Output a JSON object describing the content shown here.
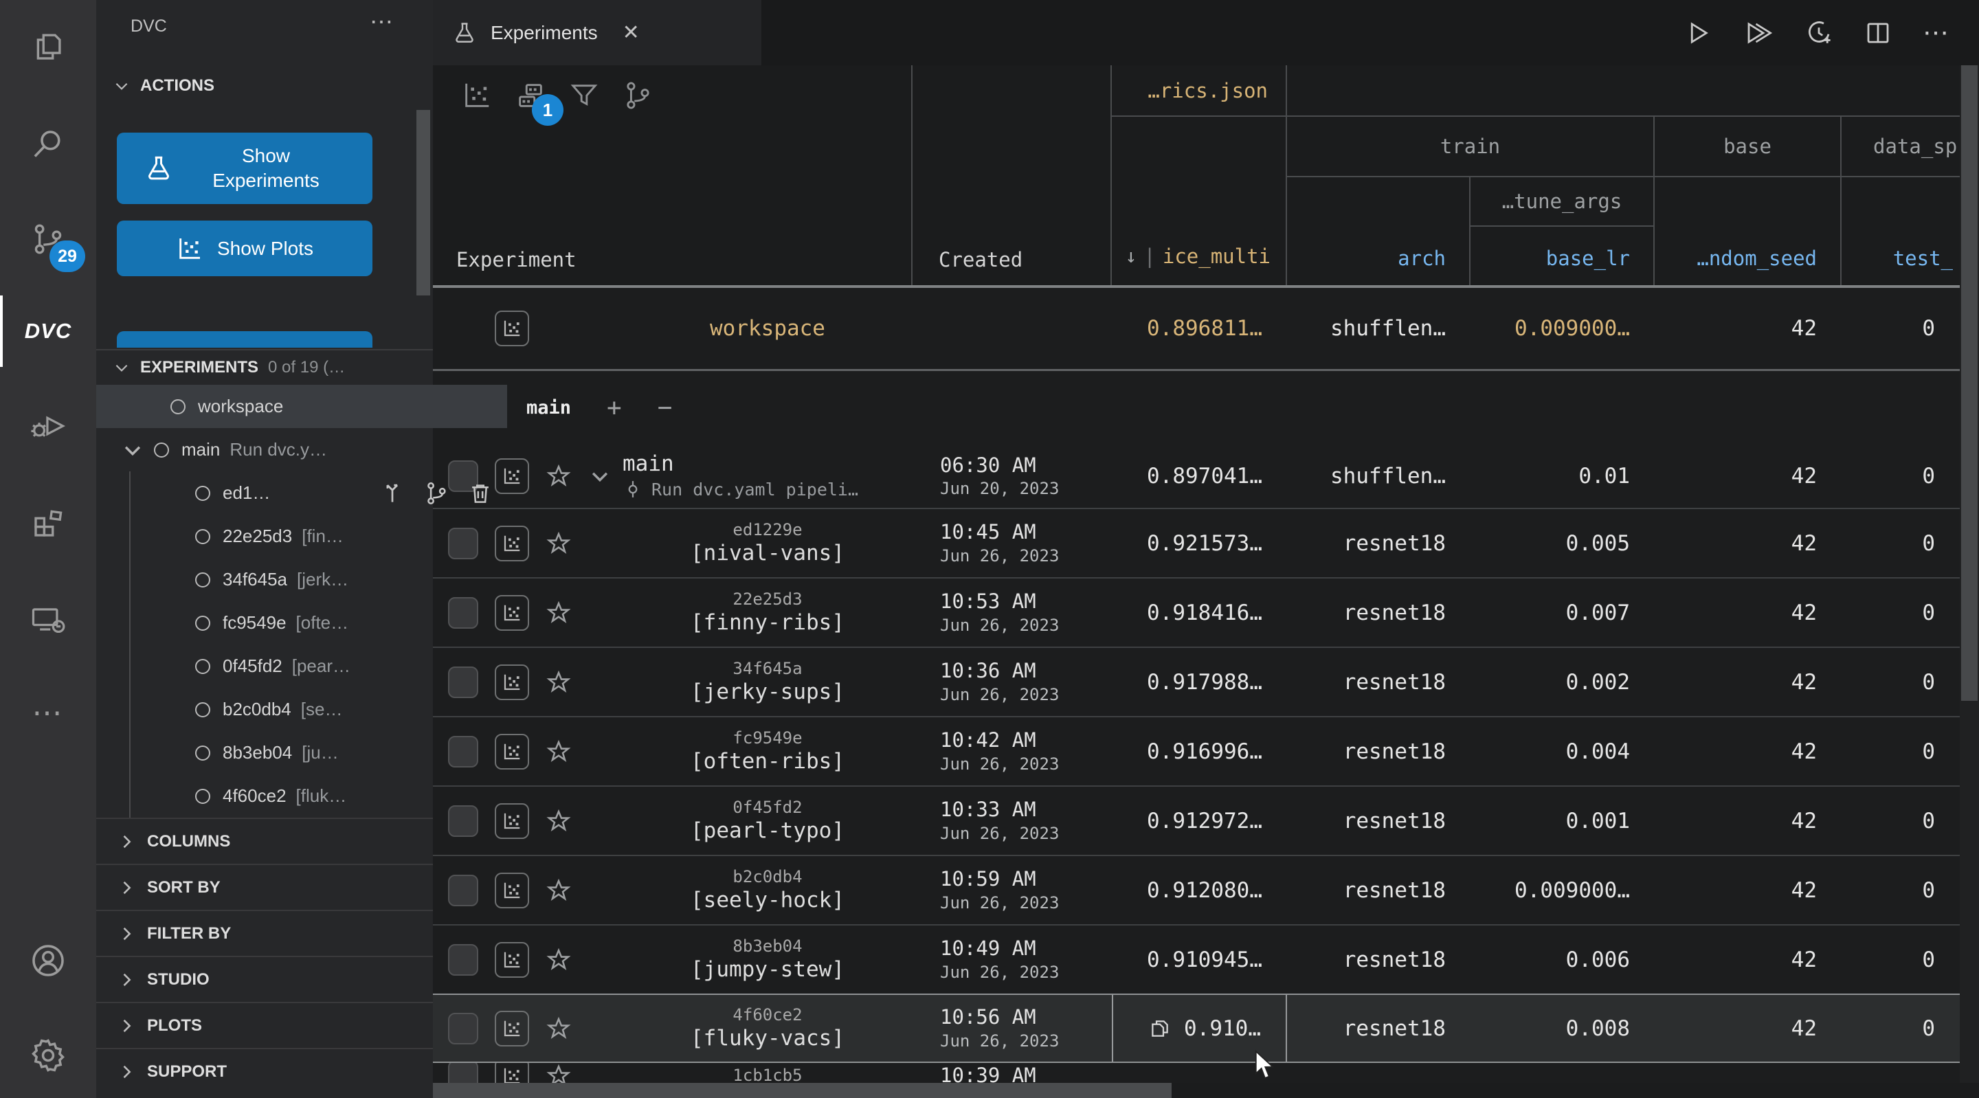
{
  "colors": {
    "accent_blue": "#1573b2",
    "badge_blue": "#1b86d3",
    "metric_tan": "#d9b679",
    "param_blue": "#77b7f0",
    "branch_blue": "#3f94e0"
  },
  "activity_bar": {
    "items": [
      {
        "icon": "files-icon"
      },
      {
        "icon": "search-icon"
      },
      {
        "icon": "source-control-icon",
        "badge": "29"
      },
      {
        "icon": "dvc-icon",
        "label": "DVC",
        "active": true
      },
      {
        "icon": "debug-icon"
      },
      {
        "icon": "extensions-icon"
      },
      {
        "icon": "remote-icon"
      },
      {
        "icon": "more-icon"
      }
    ],
    "bottom_items": [
      {
        "icon": "account-icon"
      },
      {
        "icon": "settings-icon"
      }
    ]
  },
  "sidebar": {
    "title": "DVC",
    "menu": "⋯",
    "actions": {
      "label": "ACTIONS",
      "buttons": [
        {
          "label": "Show Experiments",
          "icon": "flask-icon"
        },
        {
          "label": "Show Plots",
          "icon": "scatter-icon"
        },
        {
          "label": "",
          "icon": ""
        }
      ]
    },
    "experiments_header": {
      "label": "EXPERIMENTS",
      "count": "0 of 19 (…"
    },
    "tree": [
      {
        "label": "workspace",
        "selected": true,
        "indent": 0
      },
      {
        "label": "main",
        "desc": "Run dvc.y…",
        "chevron": true,
        "indent": 0
      },
      {
        "label": "ed1…",
        "indent": 1,
        "actions": [
          "apply-icon",
          "branch-icon",
          "trash-icon"
        ]
      },
      {
        "label": "22e25d3",
        "desc": "[fin…",
        "indent": 1
      },
      {
        "label": "34f645a",
        "desc": "[jerk…",
        "indent": 1
      },
      {
        "label": "fc9549e",
        "desc": "[ofte…",
        "indent": 1
      },
      {
        "label": "0f45fd2",
        "desc": "[pear…",
        "indent": 1
      },
      {
        "label": "b2c0db4",
        "desc": "[se…",
        "indent": 1
      },
      {
        "label": "8b3eb04",
        "desc": "[ju…",
        "indent": 1
      },
      {
        "label": "4f60ce2",
        "desc": "[fluk…",
        "indent": 1
      }
    ],
    "sections": [
      "COLUMNS",
      "SORT BY",
      "FILTER BY",
      "STUDIO",
      "PLOTS",
      "SUPPORT"
    ]
  },
  "editor": {
    "tab": {
      "label": "Experiments",
      "icon": "flask-icon",
      "close": "✕"
    },
    "actions": [
      "run-icon",
      "run-all-icon",
      "clock-add-icon",
      "split-editor-icon",
      "ellipsis-icon"
    ]
  },
  "table": {
    "toolbar": {
      "icons": [
        "scatter-icon",
        "columns-icon",
        "filter-icon",
        "branch-icon"
      ],
      "columns_badge": "1"
    },
    "header": {
      "experiment": "Experiment",
      "created": "Created",
      "metrics_file": "…rics.json",
      "metric_leaf": "ice_multi",
      "sort_arrow": "↓",
      "trunc_bar": "|",
      "group_train": "train",
      "group_base": "base",
      "group_datasp": "data_sp",
      "group_tune_args": "…tune_args",
      "arch": "arch",
      "base_lr": "base_lr",
      "seed": "…ndom_seed",
      "test": "test_"
    },
    "branch_row": {
      "name": "main",
      "add": "+",
      "remove": "−"
    },
    "rows": [
      {
        "kind": "workspace",
        "label": "workspace",
        "metric": "0.896811…",
        "arch": "shufflen…",
        "base_lr": "0.009000…",
        "seed": "42",
        "test": "0",
        "accent": {
          "label": true,
          "metric": true,
          "base_lr": true
        }
      },
      {
        "kind": "branch-head",
        "label": "main",
        "sublabel": "Run dvc.yaml pipeli…",
        "time": "06:30 AM",
        "date": "Jun 20, 2023",
        "metric": "0.897041…",
        "arch": "shufflen…",
        "base_lr": "0.01",
        "seed": "42",
        "test": "0"
      },
      {
        "kind": "exp",
        "hash": "ed1229e",
        "label": "[nival-vans]",
        "time": "10:45 AM",
        "date": "Jun 26, 2023",
        "metric": "0.921573…",
        "arch": "resnet18",
        "base_lr": "0.005",
        "seed": "42",
        "test": "0"
      },
      {
        "kind": "exp",
        "hash": "22e25d3",
        "label": "[finny-ribs]",
        "time": "10:53 AM",
        "date": "Jun 26, 2023",
        "metric": "0.918416…",
        "arch": "resnet18",
        "base_lr": "0.007",
        "seed": "42",
        "test": "0"
      },
      {
        "kind": "exp",
        "hash": "34f645a",
        "label": "[jerky-sups]",
        "time": "10:36 AM",
        "date": "Jun 26, 2023",
        "metric": "0.917988…",
        "arch": "resnet18",
        "base_lr": "0.002",
        "seed": "42",
        "test": "0"
      },
      {
        "kind": "exp",
        "hash": "fc9549e",
        "label": "[often-ribs]",
        "time": "10:42 AM",
        "date": "Jun 26, 2023",
        "metric": "0.916996…",
        "arch": "resnet18",
        "base_lr": "0.004",
        "seed": "42",
        "test": "0"
      },
      {
        "kind": "exp",
        "hash": "0f45fd2",
        "label": "[pearl-typo]",
        "time": "10:33 AM",
        "date": "Jun 26, 2023",
        "metric": "0.912972…",
        "arch": "resnet18",
        "base_lr": "0.001",
        "seed": "42",
        "test": "0"
      },
      {
        "kind": "exp",
        "hash": "b2c0db4",
        "label": "[seely-hock]",
        "time": "10:59 AM",
        "date": "Jun 26, 2023",
        "metric": "0.912080…",
        "arch": "resnet18",
        "base_lr": "0.009000…",
        "seed": "42",
        "test": "0"
      },
      {
        "kind": "exp",
        "hash": "8b3eb04",
        "label": "[jumpy-stew]",
        "time": "10:49 AM",
        "date": "Jun 26, 2023",
        "metric": "0.910945…",
        "arch": "resnet18",
        "base_lr": "0.006",
        "seed": "42",
        "test": "0"
      },
      {
        "kind": "exp",
        "hash": "4f60ce2",
        "label": "[fluky-vacs]",
        "time": "10:56 AM",
        "date": "Jun 26, 2023",
        "metric": "0.910…",
        "arch": "resnet18",
        "base_lr": "0.008",
        "seed": "42",
        "test": "0",
        "hovered": true,
        "copy_icon": true
      },
      {
        "kind": "partial",
        "hash": "1cb1cb5",
        "time": "10:39 AM"
      }
    ]
  }
}
